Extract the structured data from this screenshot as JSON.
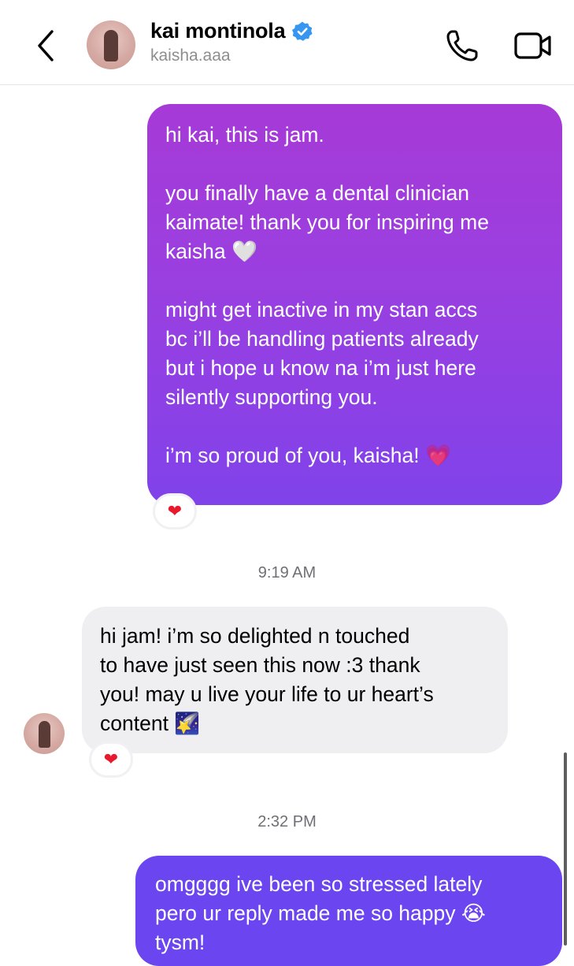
{
  "header": {
    "name": "kai montinola",
    "handle": "kaisha.aaa"
  },
  "messages": [
    {
      "direction": "outgoing",
      "text": "hi kai, this is jam.\n\nyou finally have a dental clinician\nkaimate! thank you for inspiring me\nkaisha 🤍\n\nmight get inactive in my stan accs\nbc i’ll be handling patients already\nbut i hope u know na i’m just here\nsilently supporting you.\n\ni’m so proud of you, kaisha! 💗",
      "reaction": "❤"
    },
    {
      "timestamp": "9:19 AM"
    },
    {
      "direction": "incoming",
      "text": "hi jam! i’m so delighted n touched\nto have just seen this now :3 thank\nyou! may u live your life to ur heart’s\ncontent 🌠",
      "reaction": "❤"
    },
    {
      "timestamp": "2:32 PM"
    },
    {
      "direction": "outgoing",
      "text": "omgggg ive been so stressed lately\npero ur reply made me so happy 😭\ntysm!"
    }
  ],
  "colors": {
    "outgoing_gradient_top": "#a63ad7",
    "outgoing_gradient_bottom": "#8042ea",
    "outgoing_solid": "#6b45f0",
    "incoming": "#efeff1",
    "verified": "#3797f0",
    "reaction": "#e8192c"
  },
  "icons": {
    "back": "chevron-left-icon",
    "verified": "verified-badge-icon",
    "call": "phone-icon",
    "video": "video-camera-icon"
  }
}
